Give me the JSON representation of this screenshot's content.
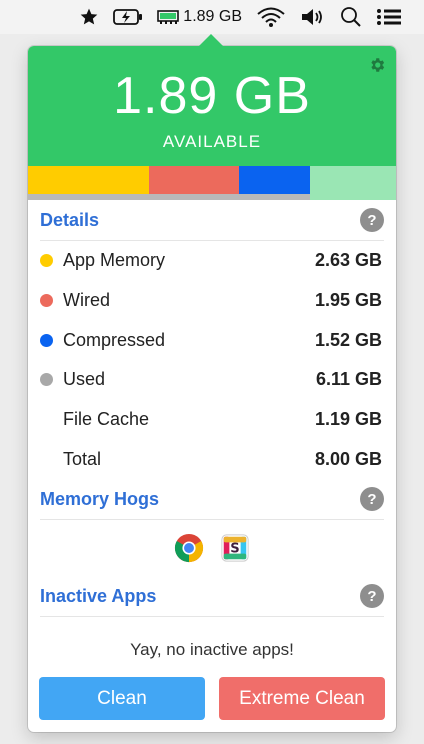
{
  "menubar": {
    "items": [
      {
        "name": "star-icon"
      },
      {
        "name": "battery-charging-icon"
      },
      {
        "name": "memory-chip-icon"
      },
      {
        "name": "wifi-icon"
      },
      {
        "name": "volume-icon"
      },
      {
        "name": "spotlight-search-icon"
      },
      {
        "name": "list-menu-icon"
      }
    ],
    "memory_text": "1.89 GB"
  },
  "header": {
    "available_value": "1.89 GB",
    "available_label": "AVAILABLE",
    "background": "#33c868"
  },
  "memory_bar": {
    "segments": [
      {
        "name": "app-memory",
        "color": "#ffcc00"
      },
      {
        "name": "wired",
        "color": "#ec6a5c"
      },
      {
        "name": "compressed",
        "color": "#0a63f0"
      },
      {
        "name": "available",
        "color": "#9ae6b4"
      }
    ]
  },
  "details": {
    "title": "Details",
    "help": "?",
    "rows": [
      {
        "label": "App Memory",
        "value": "2.63 GB",
        "color": "#ffcc00"
      },
      {
        "label": "Wired",
        "value": "1.95 GB",
        "color": "#ec6a5c"
      },
      {
        "label": "Compressed",
        "value": "1.52 GB",
        "color": "#0a63f0"
      },
      {
        "label": "Used",
        "value": "6.11 GB",
        "color": "#a8a8a8"
      },
      {
        "label": "File Cache",
        "value": "1.19 GB"
      },
      {
        "label": "Total",
        "value": "8.00 GB"
      }
    ]
  },
  "memory_hogs": {
    "title": "Memory Hogs",
    "help": "?",
    "apps": [
      {
        "name": "chrome-app-icon"
      },
      {
        "name": "slack-app-icon"
      }
    ]
  },
  "inactive_apps": {
    "title": "Inactive Apps",
    "help": "?",
    "message": "Yay, no inactive apps!"
  },
  "buttons": {
    "clean_label": "Clean",
    "extreme_label": "Extreme Clean"
  }
}
